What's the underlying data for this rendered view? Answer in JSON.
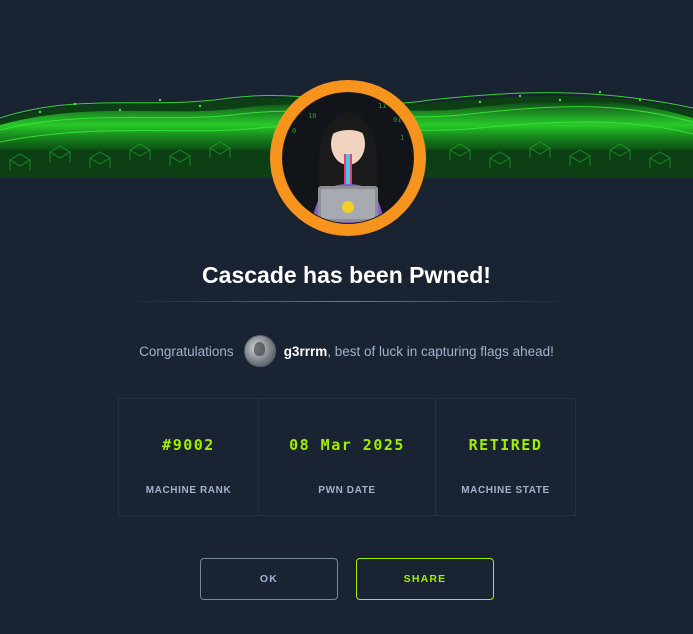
{
  "modal": {
    "title": "Cascade has been Pwned!",
    "congrats_prefix": "Congratulations",
    "username": "g3rrrm",
    "congrats_suffix": ", best of luck in capturing flags ahead!"
  },
  "stats": [
    {
      "value": "#9002",
      "label": "MACHINE RANK"
    },
    {
      "value": "08 Mar 2025",
      "label": "PWN DATE"
    },
    {
      "value": "RETIRED",
      "label": "MACHINE STATE"
    }
  ],
  "buttons": {
    "ok_label": "OK",
    "share_label": "SHARE"
  },
  "colors": {
    "accent": "#9fef00",
    "background": "#1a2332",
    "avatar_ring": "#f7941d",
    "text_muted": "#a4b1cd"
  },
  "icons": {
    "machine_avatar": "machine-avatar-icon",
    "user_avatar": "user-avatar-icon"
  }
}
